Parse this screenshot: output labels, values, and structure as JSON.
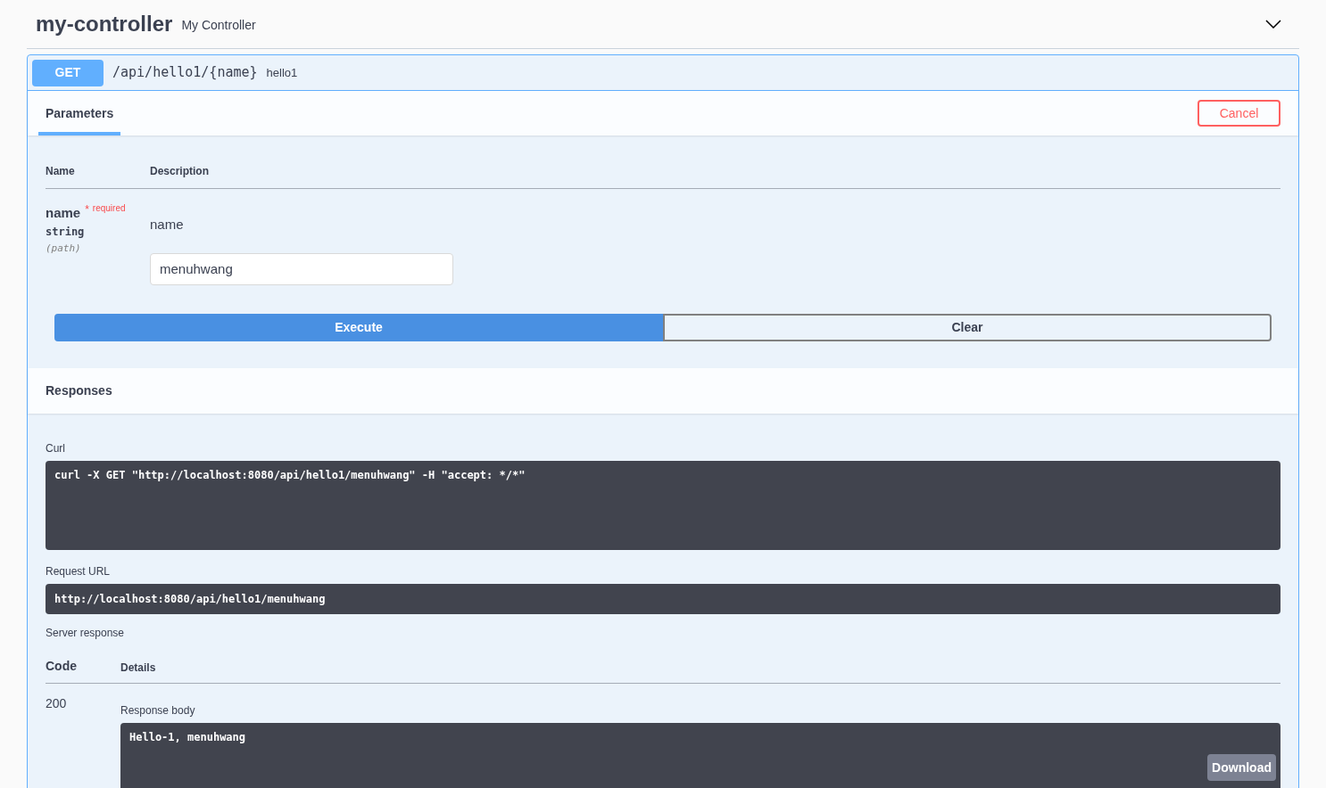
{
  "section": {
    "name": "my-controller",
    "description": "My Controller",
    "expanded": true
  },
  "operation": {
    "method": "GET",
    "path": "/api/hello1/{name}",
    "summary": "hello1"
  },
  "tabs": [
    {
      "label": "Parameters",
      "selected": true
    }
  ],
  "cancel_button": "Cancel",
  "parameters": {
    "columns": [
      "Name",
      "Description"
    ],
    "rows": [
      {
        "name": "name",
        "required_mark": "*",
        "required_label": "required",
        "type": "string",
        "location": "(path)",
        "description": "name",
        "value": "menuhwang"
      }
    ]
  },
  "actions": [
    {
      "label": "Execute",
      "kind": "primary"
    },
    {
      "label": "Clear",
      "kind": "secondary"
    }
  ],
  "responses": {
    "title": "Responses",
    "curl_label": "Curl",
    "curl": "curl -X GET \"http://localhost:8080/api/hello1/menuhwang\" -H \"accept: */*\"",
    "request_url_label": "Request URL",
    "request_url": "http://localhost:8080/api/hello1/menuhwang",
    "server_response_label": "Server response",
    "columns": [
      "Code",
      "Details"
    ],
    "rows": [
      {
        "code": "200",
        "body_label": "Response body",
        "body": "Hello-1, menuhwang",
        "download": "Download"
      }
    ]
  }
}
